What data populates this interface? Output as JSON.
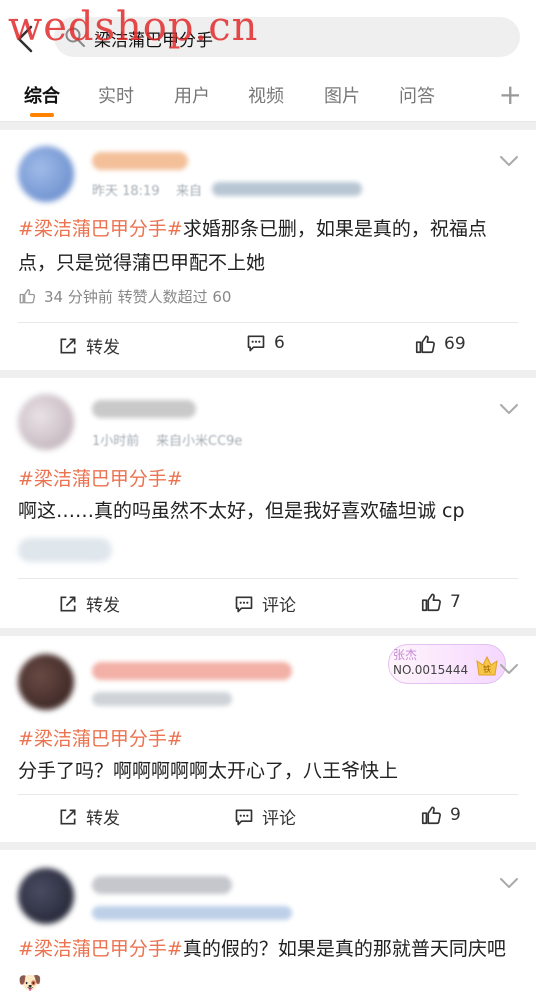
{
  "watermark": "wedshop.cn",
  "search": {
    "query": "梁洁蒲巴甲分手"
  },
  "tabs": [
    "综合",
    "实时",
    "用户",
    "视频",
    "图片",
    "问答"
  ],
  "posts": [
    {
      "meta_time": "昨天 18:19",
      "meta_source": "来自",
      "hashtag": "#梁洁蒲巴甲分手#",
      "text": "求婚那条已删，如果是真的，祝福点点，只是觉得蒲巴甲配不上她",
      "like_note": "34 分钟前 转赞人数超过 60",
      "repost_label": "转发",
      "comment_label": "6",
      "like_label": "69"
    },
    {
      "meta_time": "1小时前",
      "meta_source": "来自小米CC9e",
      "hashtag": "#梁洁蒲巴甲分手#",
      "text": "啊这……真的吗虽然不太好，但是我好喜欢磕坦诚 cp",
      "repost_label": "转发",
      "comment_label": "评论",
      "like_label": "7"
    },
    {
      "badge_name": "张杰",
      "badge_no": "NO.0015444",
      "badge_icon_text": "铁",
      "hashtag": "#梁洁蒲巴甲分手#",
      "text": "分手了吗？啊啊啊啊啊太开心了，八王爷快上",
      "repost_label": "转发",
      "comment_label": "评论",
      "like_label": "9"
    },
    {
      "hashtag": "#梁洁蒲巴甲分手#",
      "text": "真的假的？如果是真的那就普天同庆吧",
      "emoji": "🐶"
    }
  ],
  "colors": {
    "accent": "#ff8200",
    "hashtag": "#eb7350",
    "background": "#efefef"
  }
}
